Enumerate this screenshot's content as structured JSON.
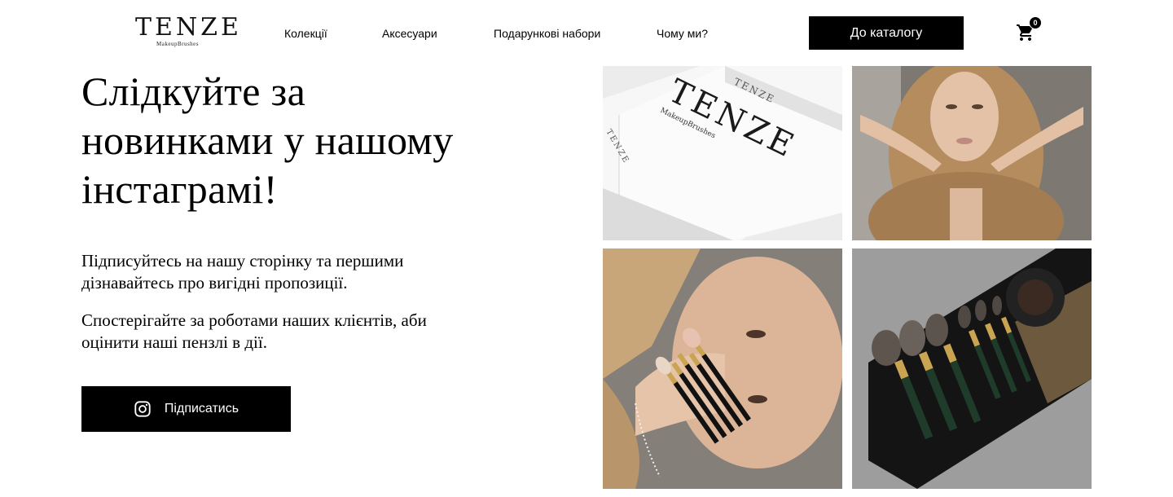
{
  "header": {
    "logo_main": "TENZE",
    "logo_sub": "MakeupBrushes",
    "nav": [
      "Колекції",
      "Аксесуари",
      "Подарункові набори",
      "Чому ми?"
    ],
    "catalog_button": "До каталогу",
    "cart_count": "0"
  },
  "hero": {
    "title_lines": [
      "Слідкуйте за",
      "новинками у нашому",
      "інстаграмі!"
    ],
    "paragraph_1_lines": [
      "Підписуйтесь на нашу сторінку та першими",
      "дізнавайтесь про вигідні пропозиції."
    ],
    "paragraph_2_lines": [
      "Спостерігайте за роботами наших клієнтів, аби",
      "оцінити наші пензлі в дії."
    ],
    "subscribe_button": "Підписатись"
  },
  "gallery": {
    "tile_1_box_text": "TENZE",
    "tile_1_box_sub": "MakeupBrushes"
  },
  "colors": {
    "primary": "#000000",
    "background": "#ffffff",
    "brush_gold": "#c9a452",
    "brush_green": "#1f3b2a"
  },
  "icons": {
    "cart": "shopping-cart-icon",
    "instagram": "instagram-icon"
  }
}
